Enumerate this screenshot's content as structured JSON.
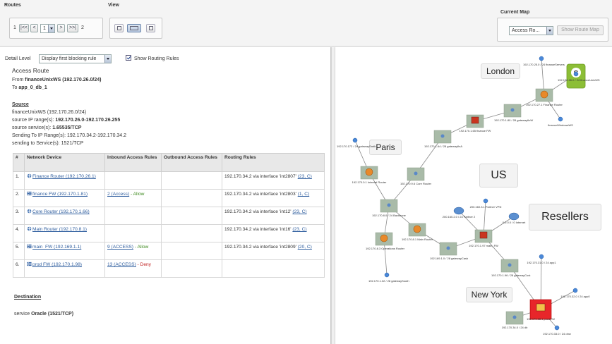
{
  "toolbar": {
    "routes_title": "Routes",
    "view_title": "View",
    "current_map_title": "Current Map",
    "pager": {
      "first": "|<<",
      "prev": "<",
      "current": "1",
      "next": ">",
      "last": ">>|",
      "start": "1",
      "total": "2"
    },
    "map_select": "Access Ro...",
    "show_route_map": "Show Route Map"
  },
  "detail": {
    "level_label": "Detail Level",
    "level_value": "Display first blocking rule",
    "show_rules_label": "Show Routing Rules",
    "heading": "Access Route",
    "from_prefix": "From",
    "from_value": "financeUnixWS (192.170.26.0/24)",
    "to_prefix": "To",
    "to_value": "app_0_db_1"
  },
  "source": {
    "heading": "Source",
    "line1": "financeUnixWS (192.170.26.0/24)",
    "line2_prefix": "source IP range(s):",
    "line2_value": "192.170.26.0-192.170.26.255",
    "line3_prefix": "source service(s):",
    "line3_value": "1.65535/TCP",
    "line4": "Sending To IP Range(s): 192.170.34.2-192.170.34.2",
    "line5": "sending to Service(s): 1521/TCP"
  },
  "table": {
    "headers": [
      "#",
      "Network Device",
      "Inbound Access Rules",
      "Outbound Access Rules",
      "Routing Rules"
    ],
    "rows": [
      {
        "num": "1.",
        "device": "Finance Router (192.170.26.1)",
        "inbound": "",
        "inbound_status": "",
        "outbound": "",
        "routing": "192.170.34.2 via interface 'int2807'",
        "routing_ref": "(23, C)"
      },
      {
        "num": "2.",
        "device": "finance FW (192.170.1.81)",
        "inbound": "2 (Access)",
        "inbound_status": "- Allow",
        "outbound": "",
        "routing": "192.170.34.2 via interface 'int2803'",
        "routing_ref": "(1, C)"
      },
      {
        "num": "3.",
        "device": "Core Router (192.170.1.66)",
        "inbound": "",
        "inbound_status": "",
        "outbound": "",
        "routing": "192.170.34.2 via interface 'int12'",
        "routing_ref": "(23, C)"
      },
      {
        "num": "4.",
        "device": "Main Router (192.170.8.1)",
        "inbound": "",
        "inbound_status": "",
        "outbound": "",
        "routing": "192.170.34.2 via interface 'int16'",
        "routing_ref": "(23, C)"
      },
      {
        "num": "5.",
        "device": "main_FW (192.169.1.1)",
        "inbound": "9 (ACCESS)",
        "inbound_status": "- Allow",
        "outbound": "",
        "routing": "192.170.34.2 via interface 'int2809'",
        "routing_ref": "(20, C)"
      },
      {
        "num": "6.",
        "device": "prod FW (192.170.1.98)",
        "inbound": "13 (ACCESS)",
        "inbound_status": "- Deny",
        "outbound": "",
        "routing": "",
        "routing_ref": ""
      }
    ]
  },
  "destination": {
    "heading": "Destination",
    "service_prefix": "service",
    "service_value": "Oracle (1521/TCP)"
  },
  "map": {
    "regions": [
      "London",
      "Paris",
      "US",
      "Resellers",
      "New York"
    ],
    "node_labels": {
      "fin_servers": "192.170.25.0 / 24 financeServers",
      "fin_ws": "192.170.26.0 / 24 financeUnixWS",
      "fin_ws2": "financeWindowsWS",
      "fin_router": "192.170.27.1 Finance Router",
      "gw_fin": "192.170.1.80 / 28 gatewayfinW",
      "fin_fw": "192.170.1.65 finance FW",
      "gw_fin2": "192.170.1.64 / 28 gatewayfinA",
      "paris_net": "192.170.172 / 24 gatewaySmth",
      "internal_router": "192.170.0.1 Internal Router",
      "core_router": "192.170.9.6 Core Router",
      "backbone": "192.170.8.0 / 24 Backbone",
      "operations_router": "192.170.8.3 Operations Router",
      "gw_south": "192.170.1.32 / 28 gatewaySouth",
      "main_router": "192.170.8.1 Main Router",
      "gw_cash": "192.169.1.0 / 28 gatewayCash",
      "partner": "200.160.2.0 / 24 Partner 2",
      "partner_vpn": "200.160.3.1 Partner VPN",
      "internet": "0.0.0.0 / 0 Internet",
      "main_fw": "192.170.1.97 main_FW",
      "gw_cust": "192.170.1.96 / 28 gatewayCust",
      "app1": "192.170.31.0 / 24 app1",
      "prod_fw": "192.170.38.1 prod FW",
      "app0": "192.170.32.0 / 24 app0",
      "db": "192.170.34.0 / 24 db",
      "dmz": "192.170.33.0 / 24 dmz"
    },
    "colors": {
      "link": "#888888",
      "highlight": "#e8262a",
      "node": "#a9bba8",
      "badge": "#8cbe36"
    }
  }
}
